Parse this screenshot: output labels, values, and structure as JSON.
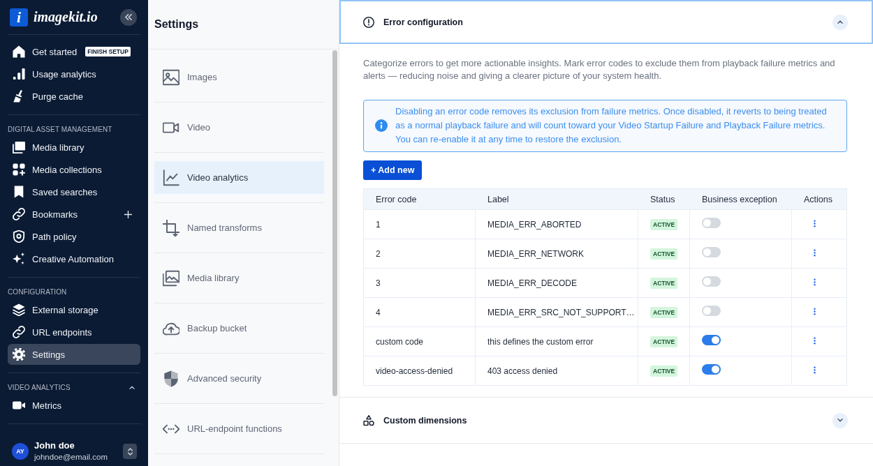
{
  "sidebar": {
    "logo_mark": "i",
    "logo_text": "imagekit.io",
    "groups": [
      {
        "items": [
          {
            "label": "Get started",
            "badge": "FINISH SETUP",
            "selected": false
          },
          {
            "label": "Usage analytics",
            "selected": false
          },
          {
            "label": "Purge cache",
            "selected": false
          }
        ]
      },
      {
        "title": "DIGITAL ASSET MANAGEMENT",
        "items": [
          {
            "label": "Media library",
            "selected": false
          },
          {
            "label": "Media collections",
            "selected": false
          },
          {
            "label": "Saved searches",
            "selected": false
          },
          {
            "label": "Bookmarks",
            "add_button": true,
            "selected": false
          },
          {
            "label": "Path policy",
            "selected": false
          },
          {
            "label": "Creative Automation",
            "selected": false
          }
        ]
      },
      {
        "title": "CONFIGURATION",
        "items": [
          {
            "label": "External storage",
            "selected": false
          },
          {
            "label": "URL endpoints",
            "selected": false
          },
          {
            "label": "Settings",
            "selected": true
          }
        ]
      },
      {
        "title": "VIDEO ANALYTICS",
        "expanded": true,
        "items": [
          {
            "label": "Metrics",
            "selected": false
          }
        ]
      }
    ],
    "user": {
      "initials": "AY",
      "name": "John doe",
      "email": "johndoe@email.com"
    }
  },
  "settings_panel": {
    "title": "Settings",
    "items": [
      {
        "label": "Images",
        "selected": false
      },
      {
        "label": "Video",
        "selected": false
      },
      {
        "label": "Video analytics",
        "selected": true
      },
      {
        "label": "Named transforms",
        "selected": false
      },
      {
        "label": "Media library",
        "selected": false
      },
      {
        "label": "Backup bucket",
        "selected": false
      },
      {
        "label": "Advanced security",
        "selected": false
      },
      {
        "label": "URL-endpoint functions",
        "selected": false
      }
    ]
  },
  "main": {
    "sections": [
      {
        "title": "Error configuration",
        "expanded": true,
        "description": "Categorize errors to get more actionable insights. Mark error codes to exclude them from playback failure metrics and alerts — reducing noise and giving a clearer picture of your system health.",
        "notice": "Disabling an error code removes its exclusion from failure metrics. Once disabled, it reverts to being treated as a normal playback failure and will count toward your Video Startup Failure and Playback Failure metrics. You can re-enable it at any time to restore the exclusion.",
        "add_button": "+ Add new",
        "table": {
          "columns": [
            "Error code",
            "Label",
            "Status",
            "Business exception",
            "Actions"
          ],
          "rows": [
            {
              "error_code": "1",
              "label": "MEDIA_ERR_ABORTED",
              "status": "ACTIVE",
              "business_exception": false
            },
            {
              "error_code": "2",
              "label": "MEDIA_ERR_NETWORK",
              "status": "ACTIVE",
              "business_exception": false
            },
            {
              "error_code": "3",
              "label": "MEDIA_ERR_DECODE",
              "status": "ACTIVE",
              "business_exception": false
            },
            {
              "error_code": "4",
              "label": "MEDIA_ERR_SRC_NOT_SUPPORT…",
              "status": "ACTIVE",
              "business_exception": false
            },
            {
              "error_code": "custom code",
              "label": "this defines the custom error",
              "status": "ACTIVE",
              "business_exception": true
            },
            {
              "error_code": "video-access-denied",
              "label": "403 access denied",
              "status": "ACTIVE",
              "business_exception": true
            }
          ]
        }
      },
      {
        "title": "Custom dimensions",
        "expanded": false
      }
    ]
  }
}
